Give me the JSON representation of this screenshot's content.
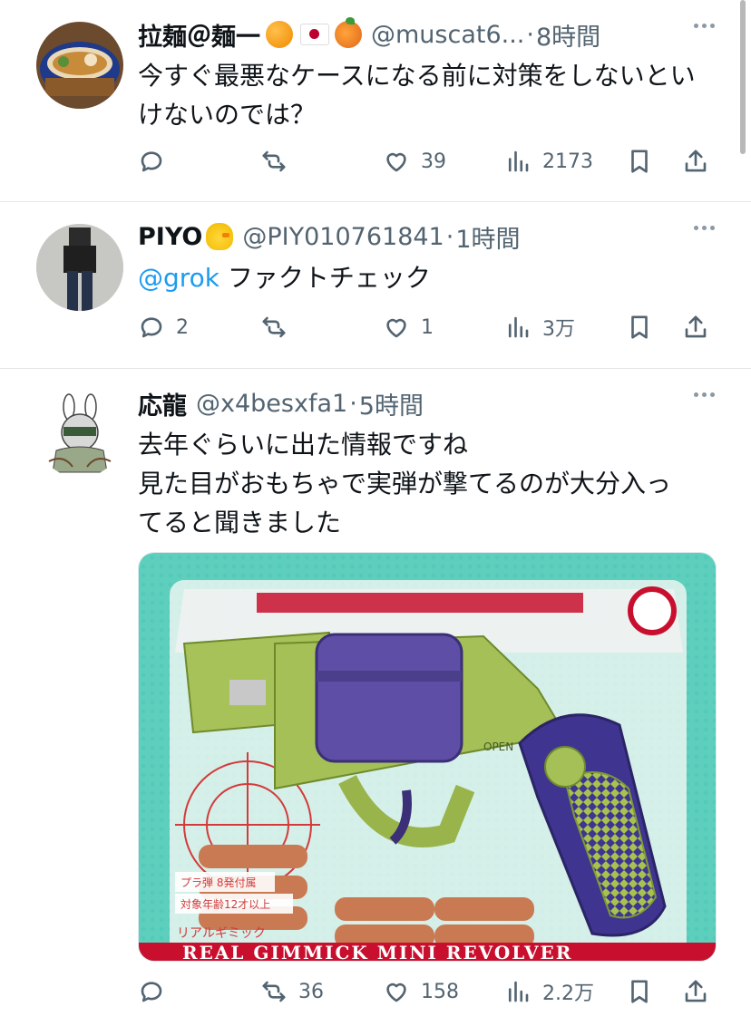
{
  "tweets": [
    {
      "name": "拉麺＠麺一",
      "handle": "@muscat6...",
      "time": "8時間",
      "text": "今すぐ最悪なケースになる前に対策をしないといけないのでは？",
      "replies": "",
      "retweets": "",
      "likes": "39",
      "views": "2173"
    },
    {
      "name": "PIYO",
      "handle": "@PIY010761841",
      "time": "1時間",
      "mention": "@grok",
      "text": "ファクトチェック",
      "replies": "2",
      "retweets": "",
      "likes": "1",
      "views": "3万"
    },
    {
      "name": "応龍",
      "handle": "@x4besxfa1",
      "time": "5時間",
      "text_lines": [
        "去年ぐらいに出た情報ですね",
        "見た目がおもちゃで実弾が撃てるのが大分入っ",
        "てると聞きました"
      ],
      "replies": "",
      "retweets": "36",
      "likes": "158",
      "views": "2.2万",
      "image": {
        "top_banner": "REAL GIMMICK MINI REVOLVER",
        "sticker_1": "プラ弾 8発付属",
        "sticker_2": "対象年齢12才以上",
        "gun_marking": "OPEN",
        "small_label": "リアルギミック"
      }
    }
  ],
  "colors": {
    "accent": "#1d9bf0",
    "muted": "#536471",
    "divider": "#e6e6e6"
  },
  "icons": [
    "reply-icon",
    "retweet-icon",
    "like-icon",
    "views-icon",
    "bookmark-icon",
    "share-icon",
    "more-icon"
  ]
}
